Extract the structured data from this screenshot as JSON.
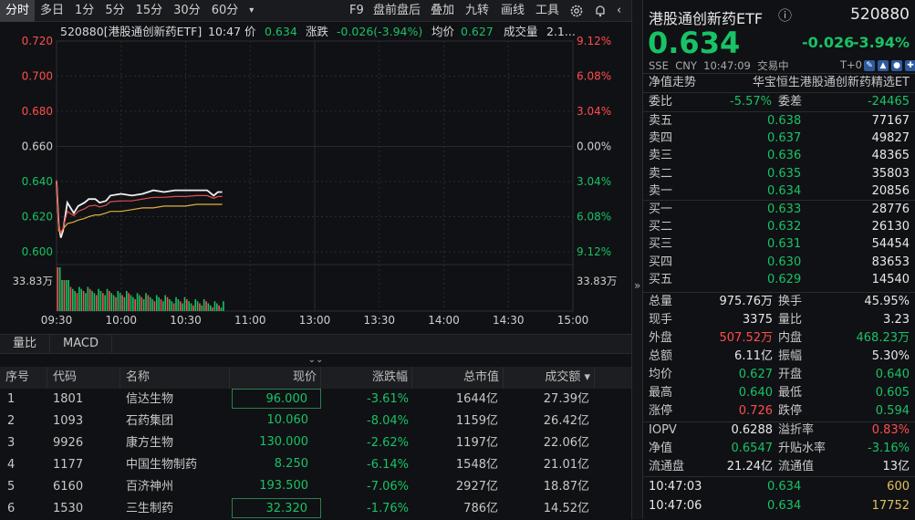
{
  "toolbar": {
    "tabs": [
      "分时",
      "多日",
      "1分",
      "5分",
      "15分",
      "30分",
      "60分"
    ],
    "more": "▾",
    "right": [
      "F9",
      "盘前盘后",
      "叠加",
      "九转",
      "画线",
      "工具"
    ]
  },
  "chart": {
    "info": {
      "name": "520880[港股通创新药ETF]",
      "time": "10:47",
      "price_label": "价",
      "price": "0.634",
      "chg_label": "涨跌",
      "chg": "-0.026(-3.94%)",
      "avg_label": "均价",
      "avg": "0.627",
      "vol_label": "成交量",
      "vol": "2.1..."
    },
    "price_ticks": [
      "0.720",
      "0.700",
      "0.680",
      "0.660",
      "0.640",
      "0.620",
      "0.600"
    ],
    "pct_ticks": [
      "9.12%",
      "6.08%",
      "3.04%",
      "0.00%",
      "3.04%",
      "6.08%",
      "9.12%"
    ],
    "vol_tick": "33.83万",
    "time_ticks": [
      "09:30",
      "10:00",
      "10:30",
      "11:00",
      "13:00",
      "13:30",
      "14:00",
      "14:30",
      "15:00"
    ]
  },
  "chart_data": {
    "type": "line",
    "title": "520880[港股通创新药ETF]",
    "ylim": [
      0.6,
      0.72
    ],
    "x": [
      "09:30",
      "09:31",
      "09:32",
      "09:33",
      "09:35",
      "09:38",
      "09:40",
      "09:43",
      "09:45",
      "09:48",
      "09:50",
      "09:53",
      "09:55",
      "10:00",
      "10:05",
      "10:10",
      "10:15",
      "10:20",
      "10:25",
      "10:30",
      "10:35",
      "10:40",
      "10:43",
      "10:45",
      "10:47"
    ],
    "series": [
      {
        "name": "价",
        "values": [
          0.64,
          0.615,
          0.608,
          0.612,
          0.628,
          0.622,
          0.626,
          0.628,
          0.63,
          0.63,
          0.628,
          0.629,
          0.632,
          0.633,
          0.632,
          0.633,
          0.635,
          0.634,
          0.635,
          0.635,
          0.635,
          0.635,
          0.632,
          0.634,
          0.634
        ]
      },
      {
        "name": "均价",
        "values": [
          0.64,
          0.612,
          0.611,
          0.613,
          0.616,
          0.617,
          0.618,
          0.619,
          0.62,
          0.621,
          0.621,
          0.622,
          0.623,
          0.623,
          0.624,
          0.625,
          0.625,
          0.626,
          0.626,
          0.626,
          0.627,
          0.627,
          0.627,
          0.627,
          0.627
        ]
      }
    ]
  },
  "indicator_tabs": [
    "量比",
    "MACD"
  ],
  "collapse": "⌄⌄",
  "table": {
    "headers": [
      "序号",
      "代码",
      "名称",
      "现价",
      "涨跌幅",
      "总市值",
      "成交额 ▾"
    ],
    "rows": [
      [
        "1",
        "1801",
        "信达生物",
        "96.000",
        "-3.61%",
        "1644亿",
        "27.39亿"
      ],
      [
        "2",
        "1093",
        "石药集团",
        "10.060",
        "-8.04%",
        "1159亿",
        "26.42亿"
      ],
      [
        "3",
        "9926",
        "康方生物",
        "130.000",
        "-2.62%",
        "1197亿",
        "22.06亿"
      ],
      [
        "4",
        "1177",
        "中国生物制药",
        "8.250",
        "-6.14%",
        "1548亿",
        "21.01亿"
      ],
      [
        "5",
        "6160",
        "百济神州",
        "193.500",
        "-7.06%",
        "2927亿",
        "18.87亿"
      ],
      [
        "6",
        "1530",
        "三生制药",
        "32.320",
        "-1.76%",
        "786亿",
        "14.52亿"
      ]
    ]
  },
  "sep_arrow": "»",
  "quote": {
    "name": "港股通创新药ETF",
    "code": "520880",
    "info_icon": "ⓘ",
    "price": "0.634",
    "chg": "-0.026",
    "pct": "-3.94%",
    "market": "SSE",
    "currency": "CNY",
    "time": "10:47:09",
    "status": "交易中",
    "t0": "T+0",
    "nav_label": "净值走势",
    "index_name": "华宝恒生港股通创新药精选ET",
    "wb_label": "委比",
    "wb": "-5.57%",
    "wc_label": "委差",
    "wc": "-24465",
    "asks": [
      [
        "卖五",
        "0.638",
        "77167"
      ],
      [
        "卖四",
        "0.637",
        "49827"
      ],
      [
        "卖三",
        "0.636",
        "48365"
      ],
      [
        "卖二",
        "0.635",
        "35803"
      ],
      [
        "卖一",
        "0.634",
        "20856"
      ]
    ],
    "bids": [
      [
        "买一",
        "0.633",
        "28776"
      ],
      [
        "买二",
        "0.632",
        "26130"
      ],
      [
        "买三",
        "0.631",
        "54454"
      ],
      [
        "买四",
        "0.630",
        "83653"
      ],
      [
        "买五",
        "0.629",
        "14540"
      ]
    ],
    "stats": [
      [
        "总量",
        "975.76万",
        "换手",
        "45.95%"
      ],
      [
        "现手",
        "3375",
        "量比",
        "3.23"
      ],
      [
        "外盘",
        "507.52万",
        "内盘",
        "468.23万"
      ],
      [
        "总额",
        "6.11亿",
        "振幅",
        "5.30%"
      ],
      [
        "均价",
        "0.627",
        "开盘",
        "0.640"
      ],
      [
        "最高",
        "0.640",
        "最低",
        "0.605"
      ],
      [
        "涨停",
        "0.726",
        "跌停",
        "0.594"
      ]
    ],
    "etf": [
      [
        "IOPV",
        "0.6288",
        "溢折率",
        "0.83%"
      ],
      [
        "净值",
        "0.6547",
        "升贴水率",
        "-3.16%"
      ],
      [
        "流通盘",
        "21.24亿",
        "流通值",
        "13亿"
      ]
    ],
    "ticks": [
      [
        "10:47:03",
        "0.634",
        "600"
      ],
      [
        "10:47:06",
        "0.634",
        "17752"
      ]
    ]
  }
}
